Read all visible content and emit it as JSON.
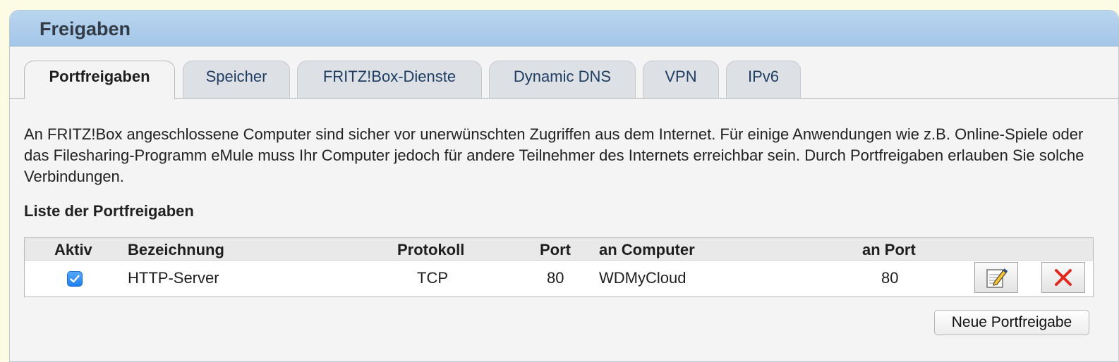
{
  "panel": {
    "title": "Freigaben"
  },
  "tabs": [
    {
      "label": "Portfreigaben",
      "active": true
    },
    {
      "label": "Speicher",
      "active": false
    },
    {
      "label": "FRITZ!Box-Dienste",
      "active": false
    },
    {
      "label": "Dynamic DNS",
      "active": false
    },
    {
      "label": "VPN",
      "active": false
    },
    {
      "label": "IPv6",
      "active": false
    }
  ],
  "intro": "An FRITZ!Box angeschlossene Computer sind sicher vor unerwünschten Zugriffen aus dem Internet. Für einige Anwendungen wie z.B. Online-Spiele oder das Filesharing-Programm eMule muss Ihr Computer jedoch für andere Teilnehmer des Internets erreichbar sein. Durch Portfreigaben erlauben Sie solche Verbindungen.",
  "list": {
    "title": "Liste der Portfreigaben",
    "columns": [
      "Aktiv",
      "Bezeichnung",
      "Protokoll",
      "Port",
      "an Computer",
      "an Port"
    ],
    "rows": [
      {
        "aktiv": true,
        "bezeichnung": "HTTP-Server",
        "protokoll": "TCP",
        "port": "80",
        "an_computer": "WDMyCloud",
        "an_port": "80",
        "actions": [
          "edit-icon",
          "delete-icon"
        ]
      }
    ]
  },
  "buttons": {
    "new_label": "Neue Portfreigabe"
  },
  "colors": {
    "header_blue": "#a3c6e8",
    "checkbox_blue": "#1e7ef2",
    "delete_red": "#e02a1f"
  }
}
